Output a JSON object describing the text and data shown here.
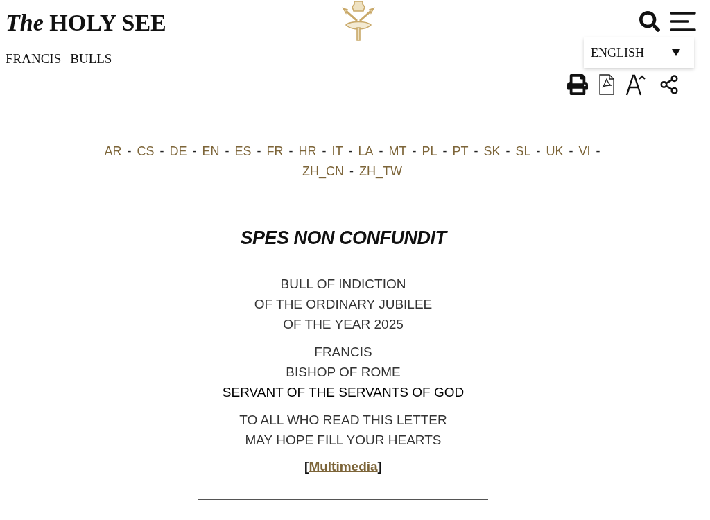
{
  "header": {
    "site_title": "*The* HOLY SEE",
    "breadcrumb": [
      "FRANCIS",
      "BULLS"
    ]
  },
  "language_select": {
    "value": "ENGLISH"
  },
  "languages": [
    {
      "code": "AR",
      "separator": "-"
    },
    {
      "code": "CS",
      "separator": "-"
    },
    {
      "code": "DE",
      "separator": "-"
    },
    {
      "code": "EN",
      "separator": "-"
    },
    {
      "code": "ES",
      "separator": "-"
    },
    {
      "code": "FR",
      "separator": "-"
    },
    {
      "code": "HR",
      "separator": "-"
    },
    {
      "code": "IT",
      "separator": "-"
    },
    {
      "code": "LA",
      "separator": "-"
    },
    {
      "code": "MT",
      "separator": "-"
    },
    {
      "code": "PL",
      "separator": "-"
    },
    {
      "code": "PT",
      "separator": "-"
    },
    {
      "code": "SK",
      "separator": "-"
    },
    {
      "code": "SL",
      "separator": "-"
    },
    {
      "code": "UK",
      "separator": "-"
    },
    {
      "code": "VI",
      "separator": "-"
    },
    {
      "code": "ZH_CN",
      "separator": "-"
    },
    {
      "code": "ZH_TW"
    }
  ],
  "document": {
    "title": "SPES NON CONFUNDIT",
    "blocks": [
      [
        {
          "text": "BULL OF INDICTION",
          "emphasis": false
        },
        {
          "text": "OF THE ORDINARY JUBILEE",
          "emphasis": false
        },
        {
          "text": "OF THE YEAR 2025",
          "emphasis": false
        }
      ],
      [
        {
          "text": "FRANCIS",
          "emphasis": false
        },
        {
          "text": "BISHOP OF ROME",
          "emphasis": false
        },
        {
          "text": "SERVANT OF THE SERVANTS OF GOD",
          "emphasis": true
        }
      ],
      [
        {
          "text": "TO ALL WHO READ THIS LETTER",
          "emphasis": false
        },
        {
          "text": "MAY HOPE FILL YOUR HEARTS",
          "emphasis": false
        }
      ]
    ],
    "multimedia": {
      "open": "[",
      "label": "Multimedia",
      "close": "]"
    }
  }
}
